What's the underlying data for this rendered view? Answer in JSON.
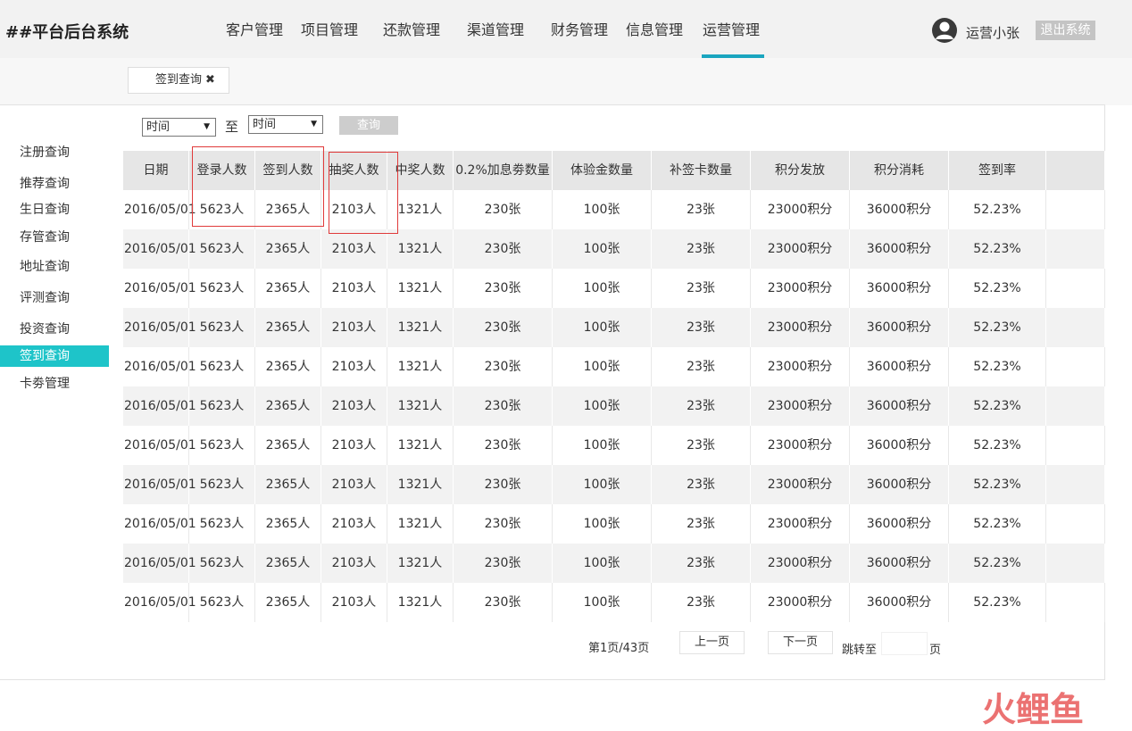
{
  "brand": "##平台后台系统",
  "nav": [
    {
      "label": "客户管理"
    },
    {
      "label": "项目管理"
    },
    {
      "label": "还款管理"
    },
    {
      "label": "渠道管理"
    },
    {
      "label": "财务管理"
    },
    {
      "label": "信息管理"
    },
    {
      "label": "运营管理",
      "active": true
    }
  ],
  "user": {
    "name": "运营小张",
    "logout": "退出系统",
    "icon": "user-avatar-icon"
  },
  "tab": {
    "label": "签到查询",
    "close": "✖"
  },
  "sidebar": [
    {
      "label": "注册查询"
    },
    {
      "label": "推荐查询"
    },
    {
      "label": "生日查询"
    },
    {
      "label": "存管查询"
    },
    {
      "label": "地址查询"
    },
    {
      "label": "评测查询"
    },
    {
      "label": "投资查询"
    },
    {
      "label": "签到查询",
      "active": true
    },
    {
      "label": "卡劵管理"
    }
  ],
  "filter": {
    "start_value": "时间",
    "separator": "至",
    "end_value": "时间",
    "query_label": "查询"
  },
  "table": {
    "headers": [
      "日期",
      "登录人数",
      "签到人数",
      "抽奖人数",
      "中奖人数",
      "0.2%加息劵数量",
      "体验金数量",
      "补签卡数量",
      "积分发放",
      "积分消耗",
      "签到率",
      ""
    ],
    "rows": [
      [
        "2016/05/01",
        "5623人",
        "2365人",
        "2103人",
        "1321人",
        "230张",
        "100张",
        "23张",
        "23000积分",
        "36000积分",
        "52.23%",
        ""
      ],
      [
        "2016/05/01",
        "5623人",
        "2365人",
        "2103人",
        "1321人",
        "230张",
        "100张",
        "23张",
        "23000积分",
        "36000积分",
        "52.23%",
        ""
      ],
      [
        "2016/05/01",
        "5623人",
        "2365人",
        "2103人",
        "1321人",
        "230张",
        "100张",
        "23张",
        "23000积分",
        "36000积分",
        "52.23%",
        ""
      ],
      [
        "2016/05/01",
        "5623人",
        "2365人",
        "2103人",
        "1321人",
        "230张",
        "100张",
        "23张",
        "23000积分",
        "36000积分",
        "52.23%",
        ""
      ],
      [
        "2016/05/01",
        "5623人",
        "2365人",
        "2103人",
        "1321人",
        "230张",
        "100张",
        "23张",
        "23000积分",
        "36000积分",
        "52.23%",
        ""
      ],
      [
        "2016/05/01",
        "5623人",
        "2365人",
        "2103人",
        "1321人",
        "230张",
        "100张",
        "23张",
        "23000积分",
        "36000积分",
        "52.23%",
        ""
      ],
      [
        "2016/05/01",
        "5623人",
        "2365人",
        "2103人",
        "1321人",
        "230张",
        "100张",
        "23张",
        "23000积分",
        "36000积分",
        "52.23%",
        ""
      ],
      [
        "2016/05/01",
        "5623人",
        "2365人",
        "2103人",
        "1321人",
        "230张",
        "100张",
        "23张",
        "23000积分",
        "36000积分",
        "52.23%",
        ""
      ],
      [
        "2016/05/01",
        "5623人",
        "2365人",
        "2103人",
        "1321人",
        "230张",
        "100张",
        "23张",
        "23000积分",
        "36000积分",
        "52.23%",
        ""
      ],
      [
        "2016/05/01",
        "5623人",
        "2365人",
        "2103人",
        "1321人",
        "230张",
        "100张",
        "23张",
        "23000积分",
        "36000积分",
        "52.23%",
        ""
      ],
      [
        "2016/05/01",
        "5623人",
        "2365人",
        "2103人",
        "1321人",
        "230张",
        "100张",
        "23张",
        "23000积分",
        "36000积分",
        "52.23%",
        ""
      ]
    ]
  },
  "pagination": {
    "page_info": "第1页/43页",
    "prev": "上一页",
    "next": "下一页",
    "jump_label": "跳转至",
    "page_unit": "页",
    "jump_value": ""
  },
  "watermark": "火鲤鱼",
  "colors": {
    "accent": "#1aa5bf",
    "sidebar_active": "#1ec4c9",
    "highlight_box": "#e03a3a",
    "button_disabled": "#cdcdcd",
    "header_bg": "#f2f2f2"
  }
}
